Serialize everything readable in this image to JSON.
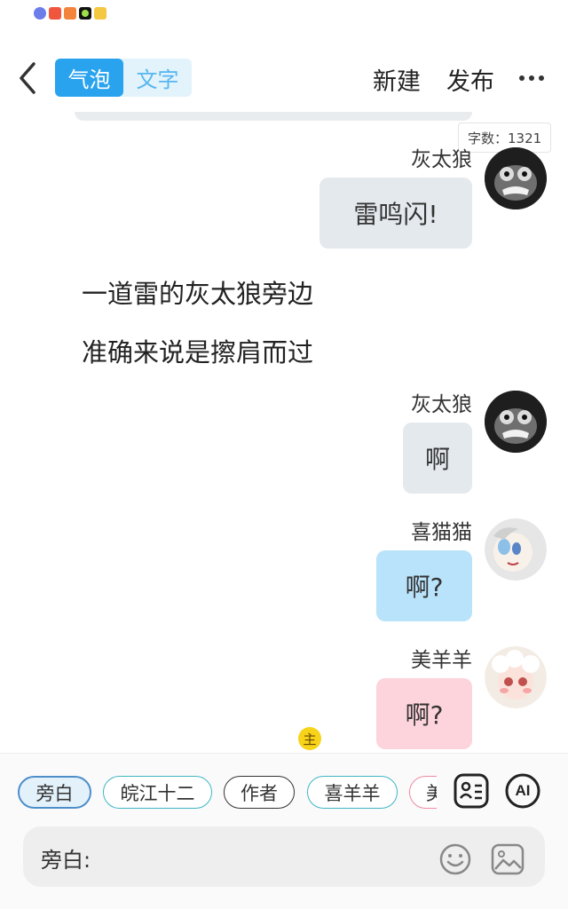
{
  "status_bar": {
    "icons": [
      "music-app-icon",
      "video-app-icon",
      "player-app-icon",
      "green-app-icon",
      "folder-app-icon"
    ],
    "icon_colors": [
      "#6b7de8",
      "#f0563d",
      "#f2843c",
      "#111111",
      "#f5c842"
    ]
  },
  "header": {
    "back_icon": "chevron-left-icon",
    "tabs": [
      {
        "label": "气泡",
        "active": true
      },
      {
        "label": "文字",
        "active": false
      }
    ],
    "new_label": "新建",
    "publish_label": "发布",
    "more_icon": "more-horizontal-icon"
  },
  "chat": {
    "word_count": "字数：1321",
    "messages": [
      {
        "type": "bubble",
        "sender": "灰太狼",
        "text": "雷鸣闪!",
        "style": "grey",
        "avatar": "grey-wolf-avatar"
      },
      {
        "type": "narration",
        "text": "一道雷的灰太狼旁边"
      },
      {
        "type": "narration",
        "text": "准确来说是擦肩而过"
      },
      {
        "type": "bubble",
        "sender": "灰太狼",
        "text": "啊",
        "style": "grey",
        "avatar": "grey-wolf-avatar"
      },
      {
        "type": "bubble",
        "sender": "喜猫猫",
        "text": "啊?",
        "style": "blue",
        "avatar": "xi-maomao-avatar"
      },
      {
        "type": "bubble",
        "sender": "美羊羊",
        "text": "啊?",
        "style": "pink",
        "avatar": "mei-yangyang-avatar"
      }
    ]
  },
  "character_bar": {
    "chips": [
      {
        "label": "旁白",
        "selected": true
      },
      {
        "label": "皖江十二"
      },
      {
        "label": "作者"
      },
      {
        "label": "喜羊羊"
      },
      {
        "label": "美"
      }
    ],
    "host_badge": "主",
    "character_icon": "character-card-icon",
    "ai_label": "AI"
  },
  "input": {
    "label": "旁白:",
    "value": "",
    "emoji_icon": "emoji-icon",
    "image_icon": "image-icon"
  },
  "colors": {
    "accent": "#2aa3ef",
    "grey_bubble": "#e4e9ee",
    "blue_bubble": "#b9e3fb",
    "pink_bubble": "#fdd3dc"
  }
}
